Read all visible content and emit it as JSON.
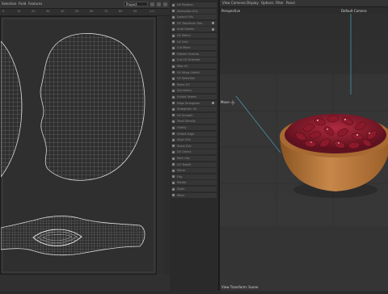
{
  "uv_editor": {
    "menu": [
      "Selection",
      "Field",
      "Features"
    ],
    "projection_dropdown": "Project",
    "ruler_ticks": [
      "0",
      "10",
      "20",
      "30",
      "40",
      "50",
      "60",
      "70",
      "80",
      "90",
      "1.0"
    ]
  },
  "tool_list": [
    "UV Position",
    "Normalize UVs",
    "Layout UVs",
    "UV Transform Tool",
    "Auto Seams",
    "UV Match",
    "UV Grid",
    "Cut Move",
    "Flatten Unwrap",
    "Cut UV Selected",
    "Map UV",
    "UV Wrap Unfold",
    "UV Selection",
    "Relax UV",
    "Symmetry",
    "Unfold Seams",
    "Edge Straighten",
    "Straighten UV",
    "UV Smooth",
    "Texel Density",
    "Gridify",
    "Unfold Edge",
    "Align UVs",
    "Stack UVs",
    "UV Orient",
    "Pack UVs",
    "UV Toolkit",
    "Mirror",
    "Flip",
    "Rotate",
    "Scale",
    "Move"
  ],
  "viewport": {
    "menu": [
      "View",
      "Cameras",
      "Display",
      "Options",
      "Filter",
      "Panel"
    ],
    "view_label": "Perspective",
    "camera_label": "Default Camera",
    "status": "View Transform: Scene",
    "move_label": "Move"
  },
  "colors": {
    "bowl": "#b87a3e",
    "beans": "#8e1a2a",
    "accent": "#55b4d4"
  }
}
